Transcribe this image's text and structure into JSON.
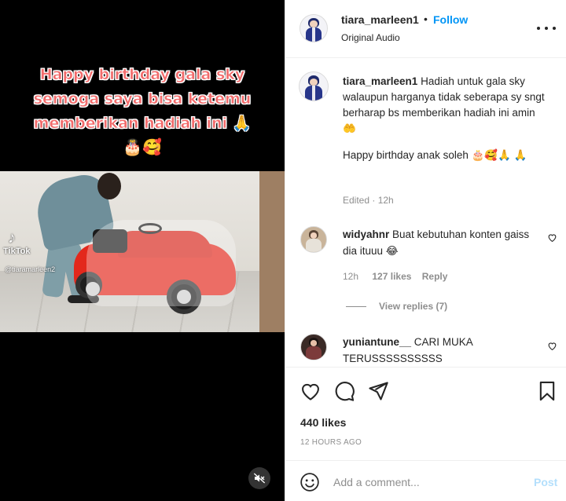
{
  "media": {
    "overlay_lines": [
      "Happy birthday gala sky",
      "semoga saya bisa ketemu",
      "memberikan hadiah ini 🙏",
      "🎂🥰"
    ],
    "watermark_brand": "TikTok",
    "watermark_user": "@tiaramarleen2",
    "mute_icon": "speaker-muted-icon"
  },
  "header": {
    "username": "tiara_marleen1",
    "separator": "•",
    "follow_label": "Follow",
    "audio": "Original Audio",
    "more_icon": "more-options-icon"
  },
  "caption": {
    "username": "tiara_marleen1",
    "text": "Hadiah untuk gala sky walaupun harganya tidak seberapa sy sngt berharap bs memberikan hadiah ini amin 🤲",
    "text2": "Happy birthday anak soleh 🎂🥰🙏 🙏",
    "edited": "Edited",
    "time": "12h"
  },
  "comments": [
    {
      "username": "widyahnr",
      "text": "Buat kebutuhan konten gaiss dia ituuu 😂",
      "time": "12h",
      "likes": "127 likes",
      "reply_label": "Reply",
      "view_replies": "View replies (7)"
    },
    {
      "username": "yuniantune__",
      "text": "CARI MUKA TERUSSSSSSSSSS"
    }
  ],
  "actions": {
    "icons": [
      "heart-icon",
      "comment-icon",
      "share-icon",
      "bookmark-icon"
    ],
    "likes": "440 likes",
    "timestamp": "12 HOURS AGO"
  },
  "add_comment": {
    "placeholder": "Add a comment...",
    "post_label": "Post",
    "emoji_icon": "emoji-icon"
  },
  "colors": {
    "accent": "#0095f6",
    "post_disabled": "#b3dffc",
    "overlay_text": "#f26b6b"
  }
}
